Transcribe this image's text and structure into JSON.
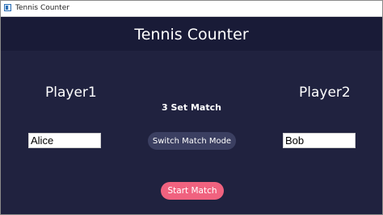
{
  "window": {
    "title": "Tennis Counter",
    "icon": "app-window-icon"
  },
  "app": {
    "heading": "Tennis Counter"
  },
  "players": {
    "player1_label": "Player1",
    "player2_label": "Player2",
    "player1_name": "Alice",
    "player2_name": "Bob"
  },
  "match": {
    "mode_text": "3 Set Match",
    "switch_button": "Switch Match Mode",
    "start_button": "Start Match"
  },
  "colors": {
    "background": "#20223f",
    "header": "#191b37",
    "switch_button": "#3b3f61",
    "start_button": "#f0627f"
  }
}
